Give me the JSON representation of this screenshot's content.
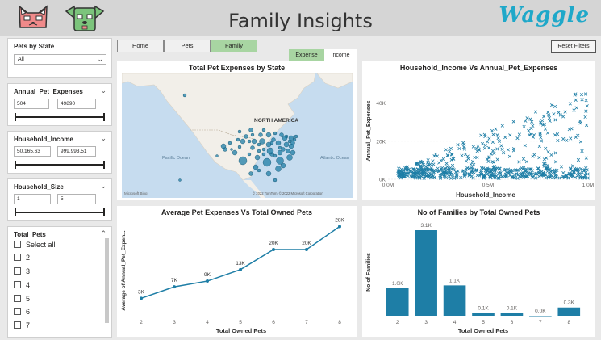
{
  "header": {
    "title": "Family Insights",
    "brand": "Waggle",
    "cat_logo": "cat-logo-icon",
    "dog_logo": "dog-logo-icon"
  },
  "nav": {
    "tabs": [
      {
        "label": "Home",
        "active": false
      },
      {
        "label": "Pets",
        "active": false
      },
      {
        "label": "Family",
        "active": true
      }
    ],
    "sub_tabs": [
      {
        "label": "Expense",
        "active": true
      },
      {
        "label": "Income",
        "active": false
      }
    ],
    "reset_label": "Reset Filters"
  },
  "slicers": {
    "pets_by_state": {
      "title": "Pets by State",
      "value": "All"
    },
    "annual_pet_expenses": {
      "title": "Annual_Pet_Expenses",
      "min": "504",
      "max": "49890"
    },
    "household_income": {
      "title": "Household_Income",
      "min": "50,165.63",
      "max": "999,993.51"
    },
    "household_size": {
      "title": "Household_Size",
      "min": "1",
      "max": "5"
    },
    "total_pets": {
      "title": "Total_Pets",
      "select_all": "Select all",
      "options": [
        "2",
        "3",
        "4",
        "5",
        "6",
        "7"
      ]
    }
  },
  "map": {
    "title": "Total Pet Expenses by State",
    "labels": {
      "continent": "NORTH AMERICA",
      "pacific": "Pacific Ocean",
      "atlantic": "Atlantic Ocean",
      "provider": "Microsoft Bing",
      "copyright": "© 2022 TomTom, © 2022 Microsoft Corporation"
    },
    "colors": {
      "land": "#f2efe9",
      "water": "#c6dcef",
      "bubble": "#1e7ea6"
    }
  },
  "chart_data": [
    {
      "type": "scatter",
      "title": "Household_Income Vs Annual_Pet_Expenses",
      "xlabel": "Household_Income",
      "ylabel": "Annual_Pet_Expenses",
      "xlim": [
        0,
        1000000
      ],
      "ylim": [
        0,
        50000
      ],
      "x_ticks": [
        "0.0M",
        "0.5M",
        "1.0M"
      ],
      "y_ticks": [
        "0K",
        "20K",
        "40K"
      ],
      "marker": "x",
      "color": "#1e7ea6"
    },
    {
      "type": "line",
      "title": "Average Pet Expenses Vs Total Owned Pets",
      "xlabel": "Total Owned Pets",
      "ylabel": "Average of Annual_Pet_Expen...",
      "x": [
        2,
        3,
        4,
        5,
        6,
        7,
        8
      ],
      "values": [
        3000,
        7000,
        9000,
        13000,
        20000,
        20000,
        28000
      ],
      "data_labels": [
        "3K",
        "7K",
        "9K",
        "13K",
        "20K",
        "20K",
        "28K"
      ],
      "color": "#1e7ea6"
    },
    {
      "type": "bar",
      "title": "No of Families by Total Owned Pets",
      "xlabel": "Total Owned Pets",
      "ylabel": "No of Families",
      "categories": [
        "2",
        "3",
        "4",
        "5",
        "6",
        "7",
        "8"
      ],
      "values": [
        1000,
        3100,
        1100,
        100,
        100,
        0,
        300
      ],
      "data_labels": [
        "1.0K",
        "3.1K",
        "1.1K",
        "0.1K",
        "0.1K",
        "0.0K",
        "0.3K"
      ],
      "color": "#1e7ea6"
    }
  ]
}
